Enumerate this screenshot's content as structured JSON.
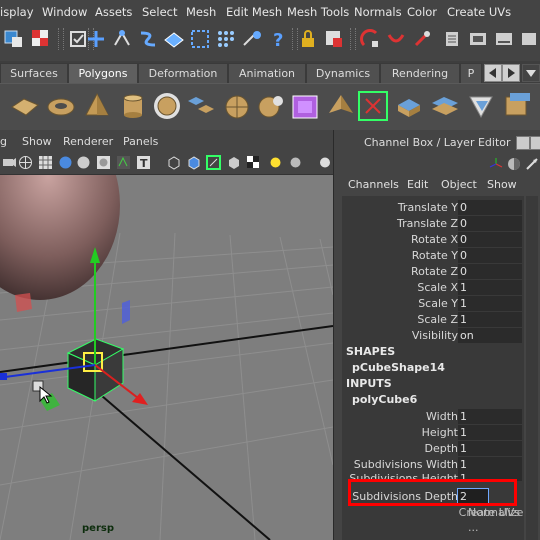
{
  "menubar": {
    "items": [
      "isplay",
      "Window",
      "Assets",
      "Select",
      "Mesh",
      "Edit Mesh",
      "Mesh Tools",
      "Normals",
      "Color",
      "Create UVs"
    ]
  },
  "shelf_tabs": {
    "tabs": [
      "Surfaces",
      "Polygons",
      "Deformation",
      "Animation",
      "Dynamics",
      "Rendering",
      "P"
    ],
    "active": "Polygons"
  },
  "viewport": {
    "menu": [
      "g",
      "Show",
      "Renderer",
      "Panels"
    ],
    "camera_label": "persp"
  },
  "channel_box": {
    "title": "Channel Box / Layer Editor",
    "menu": [
      "Channels",
      "Edit",
      "Object",
      "Show"
    ],
    "attributes": [
      {
        "label": "Translate Y",
        "value": "0"
      },
      {
        "label": "Translate Z",
        "value": "0"
      },
      {
        "label": "Rotate X",
        "value": "0"
      },
      {
        "label": "Rotate Y",
        "value": "0"
      },
      {
        "label": "Rotate Z",
        "value": "0"
      },
      {
        "label": "Scale X",
        "value": "1"
      },
      {
        "label": "Scale Y",
        "value": "1"
      },
      {
        "label": "Scale Z",
        "value": "1"
      },
      {
        "label": "Visibility",
        "value": "on"
      }
    ],
    "shapes_header": "SHAPES",
    "shape_node": "pCubeShape14",
    "inputs_header": "INPUTS",
    "input_node": "polyCube6",
    "input_attributes": [
      {
        "label": "Width",
        "value": "1"
      },
      {
        "label": "Height",
        "value": "1"
      },
      {
        "label": "Depth",
        "value": "1"
      },
      {
        "label": "Subdivisions Width",
        "value": "1"
      },
      {
        "label": "Subdivisions Height",
        "value": "1"
      },
      {
        "label": "Subdivisions Depth",
        "value": "2"
      },
      {
        "label": "Create UVs",
        "value": "Normalize ..."
      }
    ]
  },
  "colors": {
    "highlight": "#ff0000",
    "selection": "#33ff66",
    "accent": "#3f7fd6"
  }
}
